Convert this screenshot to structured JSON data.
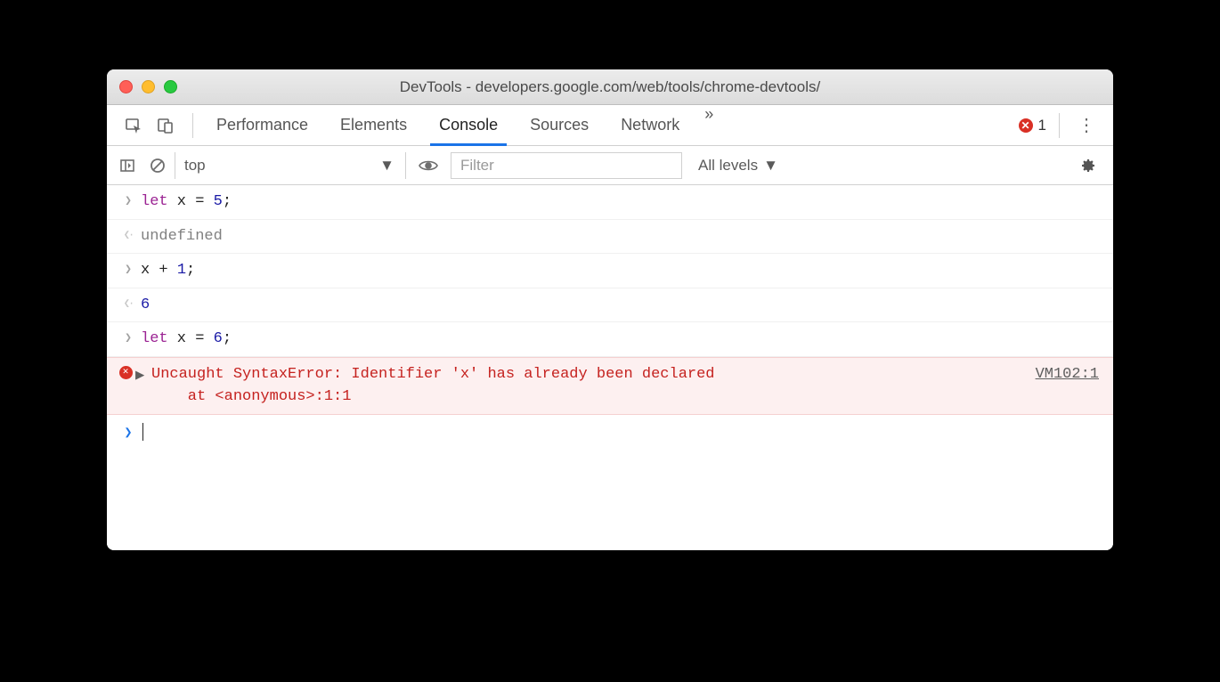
{
  "window": {
    "title": "DevTools - developers.google.com/web/tools/chrome-devtools/"
  },
  "tabs": {
    "items": [
      "Performance",
      "Elements",
      "Console",
      "Sources",
      "Network"
    ],
    "active": "Console",
    "overflow_glyph": "»",
    "error_count": "1"
  },
  "filterbar": {
    "context": "top",
    "filter_placeholder": "Filter",
    "levels_label": "All levels"
  },
  "console": {
    "lines": [
      {
        "type": "input",
        "tokens": [
          [
            "kw",
            "let"
          ],
          [
            "",
            " x "
          ],
          [
            "",
            "="
          ],
          [
            "",
            " "
          ],
          [
            "num",
            "5"
          ],
          [
            "",
            ";"
          ]
        ]
      },
      {
        "type": "output",
        "text": "undefined",
        "class": "undef"
      },
      {
        "type": "input",
        "tokens": [
          [
            "",
            "x "
          ],
          [
            "",
            "+"
          ],
          [
            "",
            " "
          ],
          [
            "num",
            "1"
          ],
          [
            "",
            ";"
          ]
        ]
      },
      {
        "type": "output",
        "text": "6",
        "class": "retnum"
      },
      {
        "type": "input",
        "tokens": [
          [
            "kw",
            "let"
          ],
          [
            "",
            " x "
          ],
          [
            "",
            "="
          ],
          [
            "",
            " "
          ],
          [
            "num",
            "6"
          ],
          [
            "",
            ";"
          ]
        ]
      }
    ],
    "error": {
      "message": "Uncaught SyntaxError: Identifier 'x' has already been declared",
      "at": "    at <anonymous>:1:1",
      "source": "VM102:1"
    }
  }
}
